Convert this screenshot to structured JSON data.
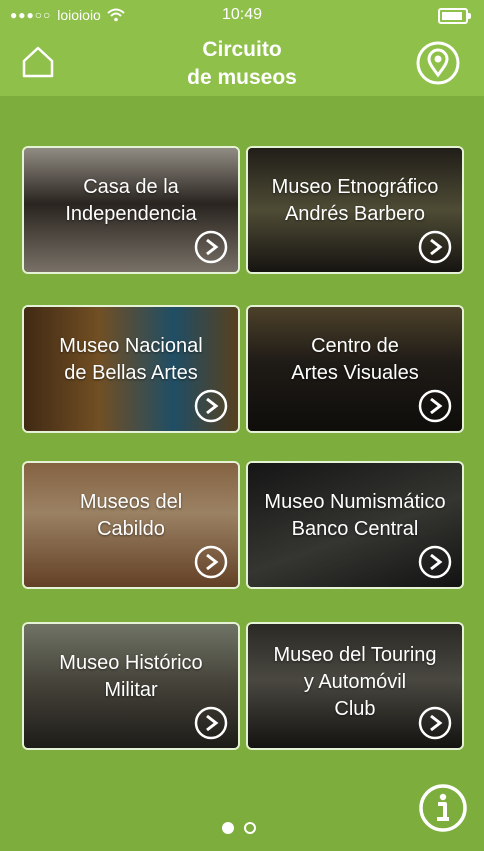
{
  "status": {
    "carrier": "loioioio",
    "time": "10:49",
    "signal_icon": "signal-dots-icon",
    "wifi_icon": "wifi-icon",
    "battery_icon": "battery-icon"
  },
  "header": {
    "title": "Circuito\nde museos",
    "home_icon": "home-icon",
    "map_icon": "map-pin-icon"
  },
  "museums": [
    {
      "label": "Casa de la\nIndependencia"
    },
    {
      "label": "Museo Etnográfico\nAndrés Barbero"
    },
    {
      "label": "Museo Nacional\nde Bellas Artes"
    },
    {
      "label": "Centro de\nArtes Visuales"
    },
    {
      "label": "Museos del\nCabildo"
    },
    {
      "label": "Museo Numismático\nBanco Central"
    },
    {
      "label": "Museo Histórico\nMilitar"
    },
    {
      "label": "Museo del Touring\ny Automóvil\nClub"
    }
  ],
  "footer": {
    "info_icon": "info-icon",
    "page_count": 2,
    "current_page": 1
  },
  "colors": {
    "background": "#7dad3c",
    "header": "#8fc04a",
    "tile_border": "#e6f2d5",
    "text": "#ffffff"
  }
}
